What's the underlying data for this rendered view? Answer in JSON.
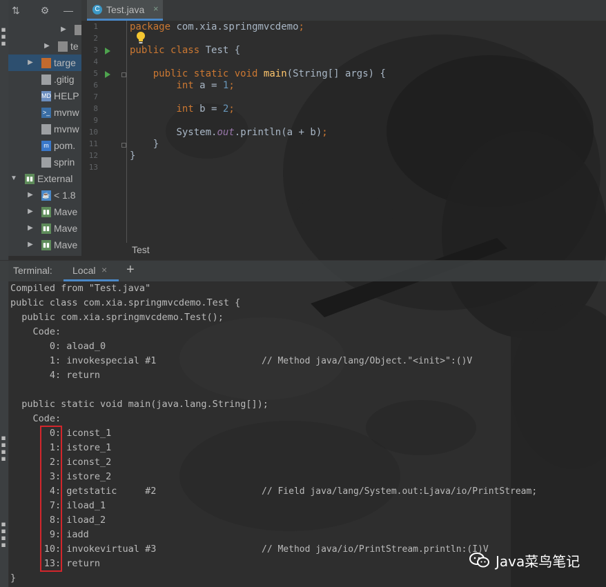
{
  "project_tree": {
    "rows": [
      {
        "label": "",
        "icon": "folder-icon",
        "arrow": "▶",
        "indent": 74,
        "selected": false
      },
      {
        "label": "te",
        "icon": "folder-icon",
        "arrow": "▶",
        "indent": 50,
        "selected": false
      },
      {
        "label": "targe",
        "icon": "folder-orange-icon",
        "arrow": "▶",
        "indent": 26,
        "selected": true
      },
      {
        "label": ".gitig",
        "icon": "file-icon",
        "arrow": "",
        "indent": 26,
        "selected": false
      },
      {
        "label": "HELP",
        "icon": "markdown-icon",
        "arrow": "",
        "indent": 26,
        "selected": false
      },
      {
        "label": "mvnw",
        "icon": "terminal-file-icon",
        "arrow": "",
        "indent": 26,
        "selected": false
      },
      {
        "label": "mvnw",
        "icon": "file-icon",
        "arrow": "",
        "indent": 26,
        "selected": false
      },
      {
        "label": "pom.",
        "icon": "maven-icon",
        "arrow": "",
        "indent": 26,
        "selected": false
      },
      {
        "label": "sprin",
        "icon": "file-icon",
        "arrow": "",
        "indent": 26,
        "selected": false
      },
      {
        "label": "External",
        "icon": "library-icon",
        "arrow": "▼",
        "indent": 2,
        "selected": false
      },
      {
        "label": "< 1.8",
        "icon": "jdk-icon",
        "arrow": "▶",
        "indent": 26,
        "selected": false
      },
      {
        "label": "Mave",
        "icon": "library-icon",
        "arrow": "▶",
        "indent": 26,
        "selected": false
      },
      {
        "label": "Mave",
        "icon": "library-icon",
        "arrow": "▶",
        "indent": 26,
        "selected": false
      },
      {
        "label": "Mave",
        "icon": "library-icon",
        "arrow": "▶",
        "indent": 26,
        "selected": false
      }
    ]
  },
  "editor": {
    "tab_label": "Test.java",
    "tab_icon_letter": "C",
    "tab_close": "×",
    "line_numbers": [
      "1",
      "2",
      "3",
      "4",
      "5",
      "6",
      "7",
      "8",
      "9",
      "10",
      "11",
      "12",
      "13"
    ],
    "code_lines": [
      "package com.xia.springmvcdemo;",
      "",
      "public class Test {",
      "",
      "    public static void main(String[] args) {",
      "        int a = 1;",
      "",
      "        int b = 2;",
      "",
      "        System.out.println(a + b);",
      "    }",
      "}",
      ""
    ],
    "breadcrumb": "Test"
  },
  "terminal": {
    "title": "Terminal:",
    "tab_label": "Local",
    "tab_close": "×",
    "add_label": "+",
    "lines": [
      {
        "text": "Compiled from \"Test.java\"",
        "comment": ""
      },
      {
        "text": "public class com.xia.springmvcdemo.Test {",
        "comment": ""
      },
      {
        "text": "  public com.xia.springmvcdemo.Test();",
        "comment": ""
      },
      {
        "text": "    Code:",
        "comment": ""
      },
      {
        "text": "       0: aload_0",
        "comment": ""
      },
      {
        "text": "       1: invokespecial #1",
        "comment": "// Method java/lang/Object.\"<init>\":()V"
      },
      {
        "text": "       4: return",
        "comment": ""
      },
      {
        "text": "",
        "comment": ""
      },
      {
        "text": "  public static void main(java.lang.String[]);",
        "comment": ""
      },
      {
        "text": "    Code:",
        "comment": ""
      },
      {
        "text": "       0: iconst_1",
        "comment": ""
      },
      {
        "text": "       1: istore_1",
        "comment": ""
      },
      {
        "text": "       2: iconst_2",
        "comment": ""
      },
      {
        "text": "       3: istore_2",
        "comment": ""
      },
      {
        "text": "       4: getstatic     #2",
        "comment": "// Field java/lang/System.out:Ljava/io/PrintStream;"
      },
      {
        "text": "       7: iload_1",
        "comment": ""
      },
      {
        "text": "       8: iload_2",
        "comment": ""
      },
      {
        "text": "       9: iadd",
        "comment": ""
      },
      {
        "text": "      10: invokevirtual #3",
        "comment": "// Method java/io/PrintStream.println:(I)V"
      },
      {
        "text": "      13: return",
        "comment": ""
      },
      {
        "text": "}",
        "comment": ""
      }
    ]
  },
  "watermark": {
    "text": "Java菜鸟笔记"
  },
  "colors": {
    "keyword": "#cc7832",
    "function": "#ffc66d",
    "number": "#6897bb",
    "static_field": "#9876aa",
    "highlight_box": "#d3262c",
    "selection": "#2d4f6f"
  }
}
